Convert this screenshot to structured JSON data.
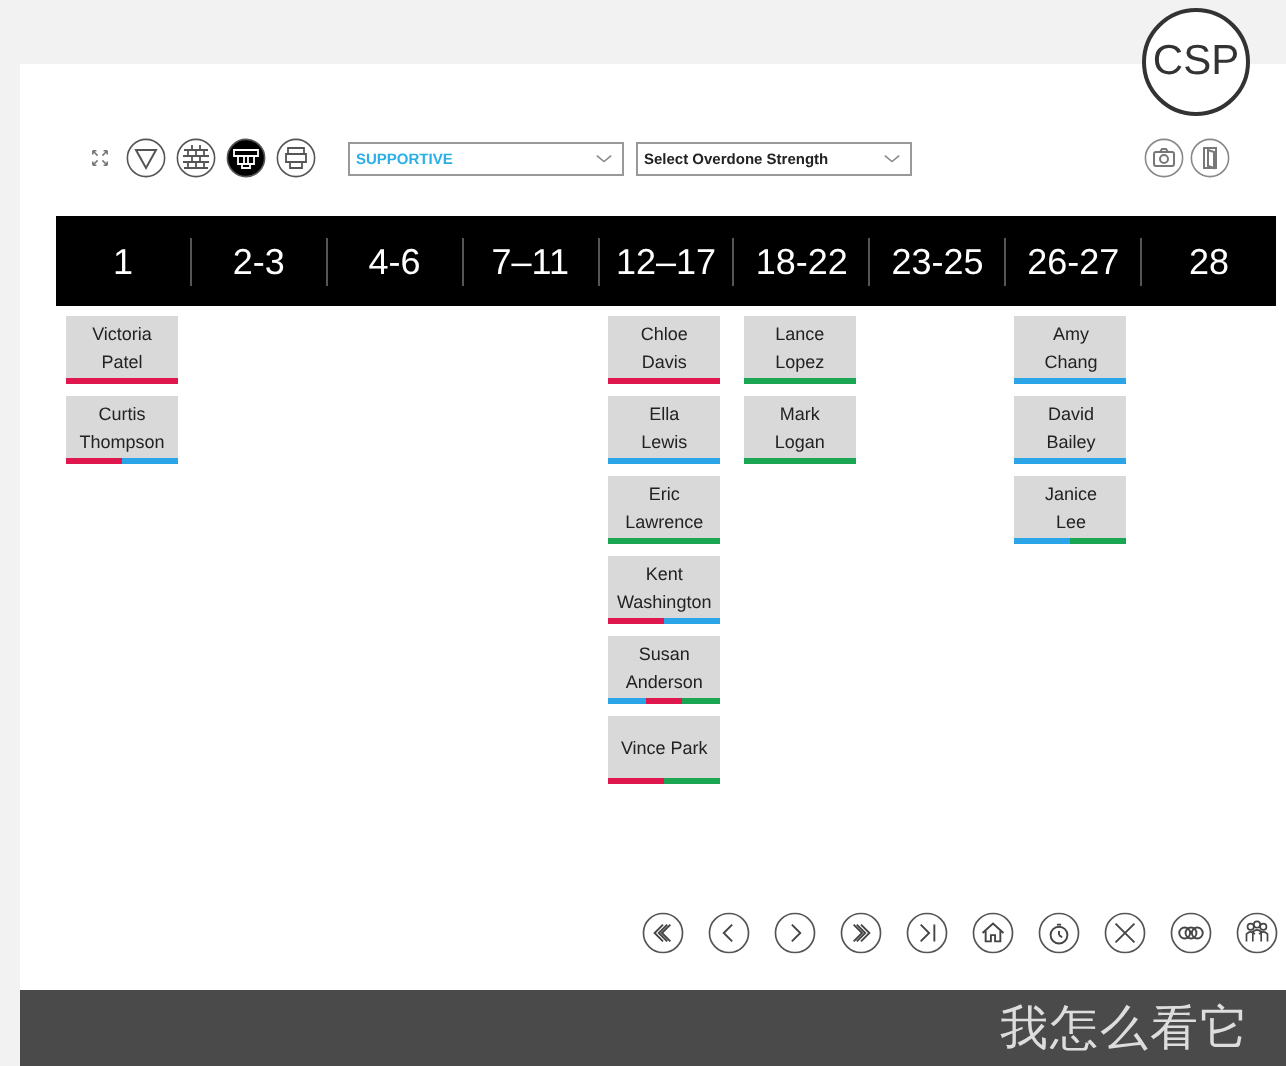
{
  "badge": "CSP",
  "toolbar": {
    "view_buttons": [
      {
        "kind": "filter",
        "selected": false
      },
      {
        "kind": "bricks",
        "selected": false
      },
      {
        "kind": "blocks",
        "selected": true
      },
      {
        "kind": "stack",
        "selected": false
      }
    ],
    "dropdowns": [
      {
        "value": "SUPPORTIVE",
        "kind": "chosen"
      },
      {
        "value": "Select Overdone Strength",
        "kind": "prompt"
      }
    ]
  },
  "columns": [
    {
      "label": "1",
      "cards": [
        {
          "first": "Victoria",
          "last": "Patel",
          "underline": [
            {
              "color": "#e0174f"
            }
          ]
        },
        {
          "first": "Curtis",
          "last": "Thompson",
          "underline": [
            {
              "color": "#e0174f"
            },
            {
              "color": "#2aa5e8"
            }
          ]
        }
      ]
    },
    {
      "label": "2-3"
    },
    {
      "label": "4-6"
    },
    {
      "label": "7–11"
    },
    {
      "label": "12–17",
      "cards": [
        {
          "first": "Chloe",
          "last": "Davis",
          "underline": [
            {
              "color": "#e0174f"
            }
          ]
        },
        {
          "first": "Ella",
          "last": "Lewis",
          "underline": [
            {
              "color": "#2aa5e8"
            }
          ]
        },
        {
          "first": "Eric",
          "last": "Lawrence",
          "underline": [
            {
              "color": "#1aa553"
            }
          ]
        },
        {
          "first": "Kent",
          "last": "Washington",
          "underline": [
            {
              "color": "#e0174f"
            },
            {
              "color": "#2aa5e8"
            }
          ]
        },
        {
          "first": "Susan",
          "last": "Anderson",
          "underline": [
            {
              "color": "#2aa5e8"
            },
            {
              "color": "#e0174f"
            },
            {
              "color": "#1aa553"
            }
          ]
        },
        {
          "first": "Vince Park",
          "underline": [
            {
              "color": "#e0174f"
            },
            {
              "color": "#1aa553"
            }
          ]
        }
      ]
    },
    {
      "label": "18-22",
      "cards": [
        {
          "first": "Lance",
          "last": "Lopez",
          "underline": [
            {
              "color": "#1aa553"
            }
          ]
        },
        {
          "first": "Mark",
          "last": "Logan",
          "underline": [
            {
              "color": "#1aa553"
            }
          ]
        }
      ]
    },
    {
      "label": "23-25"
    },
    {
      "label": "26-27",
      "cards": [
        {
          "first": "Amy",
          "last": "Chang",
          "underline": [
            {
              "color": "#2aa5e8"
            }
          ]
        },
        {
          "first": "David",
          "last": "Bailey",
          "underline": [
            {
              "color": "#2aa5e8"
            }
          ]
        },
        {
          "first": "Janice",
          "last": "Lee",
          "underline": [
            {
              "color": "#2aa5e8"
            },
            {
              "color": "#1aa553"
            }
          ]
        }
      ]
    },
    {
      "label": "28"
    }
  ],
  "nav": [
    {
      "kind": "first"
    },
    {
      "kind": "prev"
    },
    {
      "kind": "next"
    },
    {
      "kind": "last"
    },
    {
      "kind": "end"
    },
    {
      "kind": "home"
    },
    {
      "kind": "timer"
    },
    {
      "kind": "close"
    },
    {
      "kind": "link"
    },
    {
      "kind": "group"
    }
  ],
  "footer": {
    "title": "我怎么看它"
  }
}
